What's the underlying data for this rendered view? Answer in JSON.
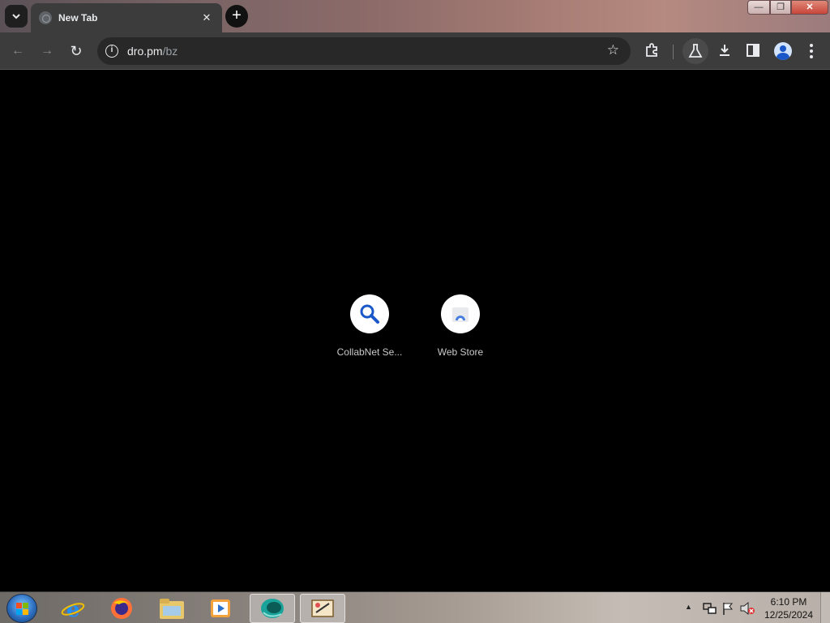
{
  "window": {
    "minimize_glyph": "—",
    "maximize_glyph": "❐",
    "close_glyph": "✕"
  },
  "tabs": [
    {
      "title": "New Tab",
      "close_glyph": "✕"
    }
  ],
  "new_tab_glyph": "+",
  "toolbar": {
    "back_glyph": "←",
    "forward_glyph": "→",
    "reload_glyph": "↻",
    "url_host": "dro.pm",
    "url_path": "/bz",
    "info_glyph": "i",
    "bookmark_glyph": "☆"
  },
  "shortcuts": [
    {
      "label": "CollabNet Se...",
      "icon": "search-icon"
    },
    {
      "label": "Web Store",
      "icon": "web-store-icon"
    }
  ],
  "taskbar": {
    "apps": [
      {
        "name": "internet-explorer"
      },
      {
        "name": "firefox"
      },
      {
        "name": "file-explorer"
      },
      {
        "name": "media-player"
      },
      {
        "name": "chrome",
        "active": true
      },
      {
        "name": "paint-app"
      }
    ],
    "clock_time": "6:10 PM",
    "clock_date": "12/25/2024",
    "tray_up_glyph": "▲"
  },
  "colors": {
    "tab_bg": "#3c3c3c",
    "omnibox_bg": "#282828",
    "page_bg": "#000000",
    "shortcut_circle": "#ffffff",
    "icon_blue": "#1a57c8"
  }
}
